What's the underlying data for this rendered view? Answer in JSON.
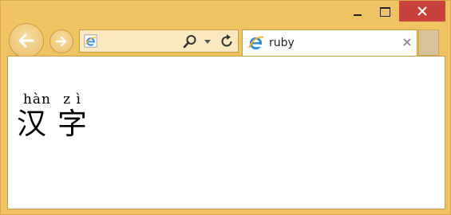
{
  "window": {
    "minimize_icon": "minimize-icon",
    "maximize_icon": "maximize-icon",
    "close_icon": "close-icon",
    "close_color": "#c7413d",
    "frame_color": "#efc362"
  },
  "navigation": {
    "back_icon": "back-arrow-icon",
    "forward_icon": "forward-arrow-icon"
  },
  "address_bar": {
    "value": "",
    "site_icon": "ie-logo-icon",
    "search_icon": "search-icon",
    "dropdown_icon": "chevron-down-icon",
    "refresh_icon": "refresh-icon"
  },
  "tab": {
    "label": "ruby",
    "icon": "ie-logo-icon",
    "close_icon": "close-tab-icon"
  },
  "content": {
    "ruby": [
      {
        "base": "汉",
        "annotation": "hàn"
      },
      {
        "base": "字",
        "annotation": "z ì"
      }
    ]
  }
}
